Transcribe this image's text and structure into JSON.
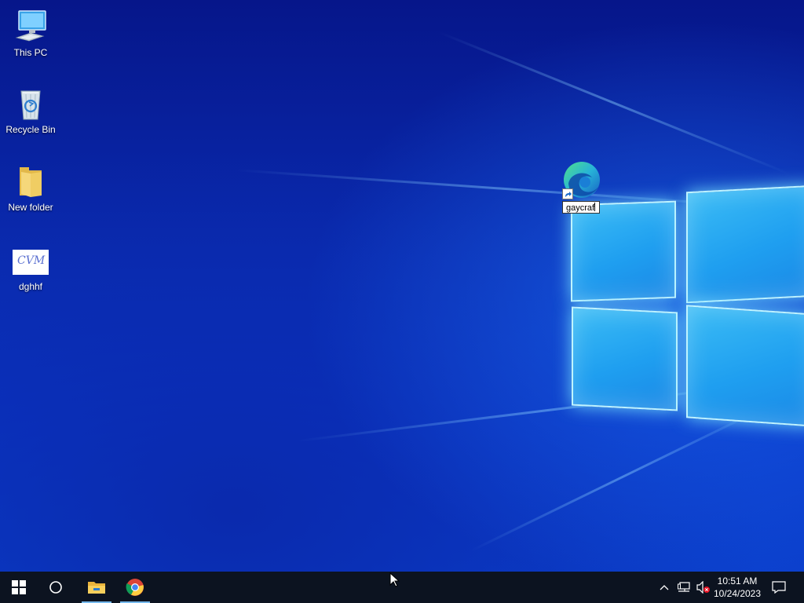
{
  "desktop": {
    "icons": [
      {
        "label": "This PC",
        "icon": "computer-icon"
      },
      {
        "label": "Recycle Bin",
        "icon": "recycle-bin-icon"
      },
      {
        "label": "New folder",
        "icon": "folder-icon"
      },
      {
        "label": "dghhf",
        "icon": "image-thumbnail-icon",
        "thumbnail_text": "CVM"
      }
    ],
    "edge_shortcut": {
      "icon": "edge-icon",
      "rename_value": "gaycraf"
    }
  },
  "taskbar": {
    "pinned": [
      "start-button",
      "search-button",
      "file-explorer-button",
      "chrome-button"
    ],
    "tray": {
      "icons": [
        "chevron-up-icon",
        "network-icon",
        "volume-muted-icon",
        "notifications-icon"
      ],
      "time": "10:51 AM",
      "date": "10/24/2023"
    }
  },
  "colors": {
    "taskbar": "#0c1320",
    "accent": "#76b9ed",
    "desktop_top": "#06168a",
    "pane": "#2aaaf2"
  }
}
